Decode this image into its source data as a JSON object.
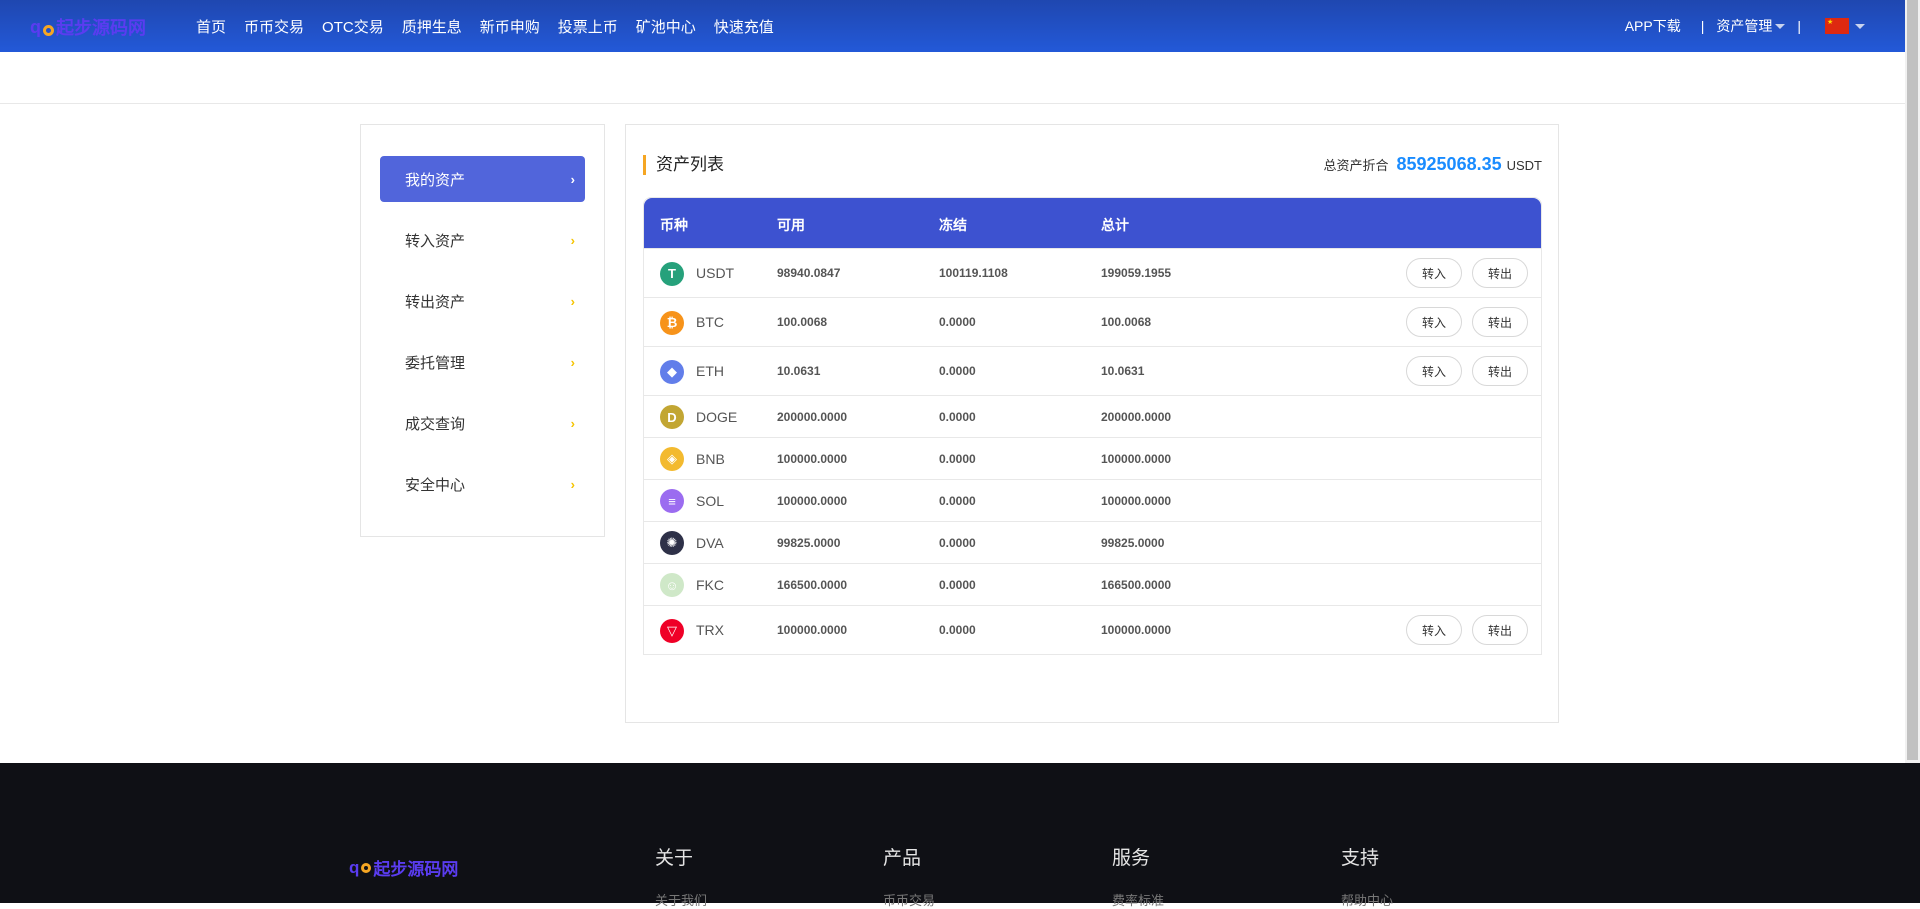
{
  "header": {
    "logo": "起步源码网",
    "logo_prefix": "q",
    "nav": [
      "首页",
      "币币交易",
      "OTC交易",
      "质押生息",
      "新币申购",
      "投票上币",
      "矿池中心",
      "快速充值"
    ],
    "app_download": "APP下载",
    "asset_mgmt": "资产管理",
    "divider": "|"
  },
  "sidebar": {
    "items": [
      {
        "label": "我的资产",
        "active": true
      },
      {
        "label": "转入资产"
      },
      {
        "label": "转出资产"
      },
      {
        "label": "委托管理"
      },
      {
        "label": "成交查询"
      },
      {
        "label": "安全中心"
      }
    ],
    "chevron": "›"
  },
  "main": {
    "title": "资产列表",
    "total_label": "总资产折合",
    "total_value": "85925068.35",
    "total_unit": "USDT",
    "columns": [
      "币种",
      "可用",
      "冻结",
      "总计"
    ],
    "deposit_label": "转入",
    "withdraw_label": "转出",
    "rows": [
      {
        "coin": "USDT",
        "available": "98940.0847",
        "frozen": "100119.1108",
        "total": "199059.1955",
        "actions": true,
        "color": "#26a17b",
        "glyph": "T"
      },
      {
        "coin": "BTC",
        "available": "100.0068",
        "frozen": "0.0000",
        "total": "100.0068",
        "actions": true,
        "color": "#f7931a",
        "glyph": "₿"
      },
      {
        "coin": "ETH",
        "available": "10.0631",
        "frozen": "0.0000",
        "total": "10.0631",
        "actions": true,
        "color": "#627eea",
        "glyph": "◆"
      },
      {
        "coin": "DOGE",
        "available": "200000.0000",
        "frozen": "0.0000",
        "total": "200000.0000",
        "actions": false,
        "color": "#c2a633",
        "glyph": "D"
      },
      {
        "coin": "BNB",
        "available": "100000.0000",
        "frozen": "0.0000",
        "total": "100000.0000",
        "actions": false,
        "color": "#f3ba2f",
        "glyph": "◈"
      },
      {
        "coin": "SOL",
        "available": "100000.0000",
        "frozen": "0.0000",
        "total": "100000.0000",
        "actions": false,
        "color": "#9b6cf0",
        "glyph": "≡"
      },
      {
        "coin": "DVA",
        "available": "99825.0000",
        "frozen": "0.0000",
        "total": "99825.0000",
        "actions": false,
        "color": "#2e3148",
        "glyph": "✺"
      },
      {
        "coin": "FKC",
        "available": "166500.0000",
        "frozen": "0.0000",
        "total": "166500.0000",
        "actions": false,
        "color": "#cfe8c8",
        "glyph": "☺"
      },
      {
        "coin": "TRX",
        "available": "100000.0000",
        "frozen": "0.0000",
        "total": "100000.0000",
        "actions": true,
        "color": "#ef0027",
        "glyph": "▽"
      }
    ]
  },
  "footer": {
    "logo": "起步源码网",
    "columns": [
      {
        "title": "关于",
        "link": "关于我们"
      },
      {
        "title": "产品",
        "link": "币币交易"
      },
      {
        "title": "服务",
        "link": "费率标准"
      },
      {
        "title": "支持",
        "link": "帮助中心"
      }
    ]
  }
}
